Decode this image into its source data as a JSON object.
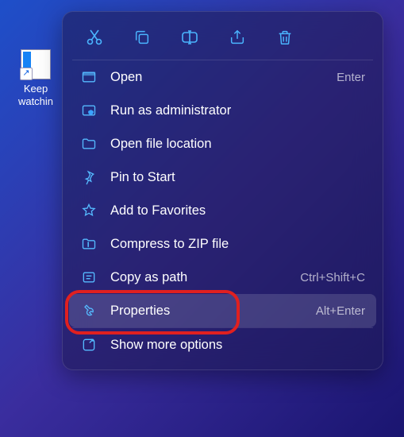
{
  "desktop": {
    "icon_label": "Keep watchin"
  },
  "action_icons": {
    "cut": "cut-icon",
    "copy": "copy-icon",
    "rename": "rename-icon",
    "share": "share-icon",
    "delete": "delete-icon"
  },
  "menu": {
    "open": {
      "label": "Open",
      "accel": "Enter"
    },
    "run_admin": {
      "label": "Run as administrator",
      "accel": ""
    },
    "open_location": {
      "label": "Open file location",
      "accel": ""
    },
    "pin_start": {
      "label": "Pin to Start",
      "accel": ""
    },
    "add_fav": {
      "label": "Add to Favorites",
      "accel": ""
    },
    "compress": {
      "label": "Compress to ZIP file",
      "accel": ""
    },
    "copy_path": {
      "label": "Copy as path",
      "accel": "Ctrl+Shift+C"
    },
    "properties": {
      "label": "Properties",
      "accel": "Alt+Enter",
      "highlighted": true,
      "annotated": true
    },
    "show_more": {
      "label": "Show more options",
      "accel": ""
    }
  }
}
